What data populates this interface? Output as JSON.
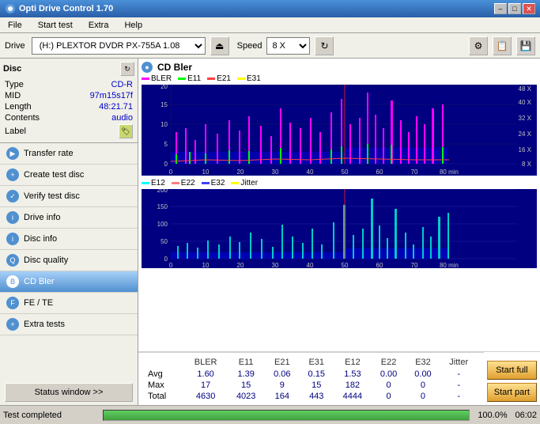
{
  "titleBar": {
    "title": "Opti Drive Control 1.70",
    "controls": {
      "minimize": "–",
      "maximize": "□",
      "close": "✕"
    }
  },
  "menuBar": {
    "items": [
      "File",
      "Start test",
      "Extra",
      "Help"
    ]
  },
  "toolbar": {
    "driveLabel": "Drive",
    "driveValue": "(H:)  PLEXTOR DVDR  PX-755A 1.08",
    "speedLabel": "Speed",
    "speedValue": "8 X"
  },
  "disc": {
    "title": "Disc",
    "fields": [
      {
        "label": "Type",
        "value": "CD-R"
      },
      {
        "label": "MID",
        "value": "97m15s17f"
      },
      {
        "label": "Length",
        "value": "48:21.71"
      },
      {
        "label": "Contents",
        "value": "audio"
      },
      {
        "label": "Label",
        "value": ""
      }
    ]
  },
  "nav": {
    "items": [
      {
        "label": "Transfer rate",
        "active": false
      },
      {
        "label": "Create test disc",
        "active": false
      },
      {
        "label": "Verify test disc",
        "active": false
      },
      {
        "label": "Drive info",
        "active": false
      },
      {
        "label": "Disc info",
        "active": false
      },
      {
        "label": "Disc quality",
        "active": false
      },
      {
        "label": "CD Bler",
        "active": true
      },
      {
        "label": "FE / TE",
        "active": false
      },
      {
        "label": "Extra tests",
        "active": false
      }
    ],
    "statusWindowBtn": "Status window >>"
  },
  "chart": {
    "title": "CD Bler",
    "topChart": {
      "legend": [
        {
          "label": "BLER",
          "color": "#ff00ff"
        },
        {
          "label": "E11",
          "color": "#00ff00"
        },
        {
          "label": "E21",
          "color": "#ff4040"
        },
        {
          "label": "E31",
          "color": "#ffff00"
        }
      ],
      "yMax": 20,
      "yTicks": [
        5,
        10,
        15,
        20
      ],
      "yRight": [
        "48X",
        "40X",
        "32X",
        "24X",
        "16X",
        "8X"
      ],
      "xMax": 80,
      "xTicks": [
        0,
        10,
        20,
        30,
        40,
        50,
        60,
        70,
        80
      ]
    },
    "bottomChart": {
      "legend": [
        {
          "label": "E12",
          "color": "#00ffff"
        },
        {
          "label": "E22",
          "color": "#ff8080"
        },
        {
          "label": "E32",
          "color": "#4040ff"
        },
        {
          "label": "Jitter",
          "color": "#ffff00"
        }
      ],
      "yMax": 200,
      "yTicks": [
        50,
        100,
        150,
        200
      ],
      "xMax": 80,
      "xTicks": [
        0,
        10,
        20,
        30,
        40,
        50,
        60,
        70,
        80
      ]
    },
    "stats": {
      "columns": [
        "",
        "BLER",
        "E11",
        "E21",
        "E31",
        "E12",
        "E22",
        "E32",
        "Jitter"
      ],
      "rows": [
        {
          "label": "Avg",
          "values": [
            "1.60",
            "1.39",
            "0.06",
            "0.15",
            "1.53",
            "0.00",
            "0.00",
            "-"
          ]
        },
        {
          "label": "Max",
          "values": [
            "17",
            "15",
            "9",
            "15",
            "182",
            "0",
            "0",
            "-"
          ]
        },
        {
          "label": "Total",
          "values": [
            "4630",
            "4023",
            "164",
            "443",
            "4444",
            "0",
            "0",
            "-"
          ]
        }
      ]
    },
    "buttons": {
      "startFull": "Start full",
      "startPart": "Start part"
    }
  },
  "statusBar": {
    "text": "Test completed",
    "progress": 100.0,
    "progressLabel": "100.0%",
    "time": "06:02"
  },
  "colors": {
    "bler": "#ff00ff",
    "e11": "#00ff00",
    "e21": "#ff4040",
    "e31": "#ffff00",
    "e12": "#00ffff",
    "e22": "#ff8080",
    "e32": "#0000ff",
    "jitter": "#ffff00",
    "chartBg": "#000080",
    "accentBlue": "#316ac5"
  }
}
